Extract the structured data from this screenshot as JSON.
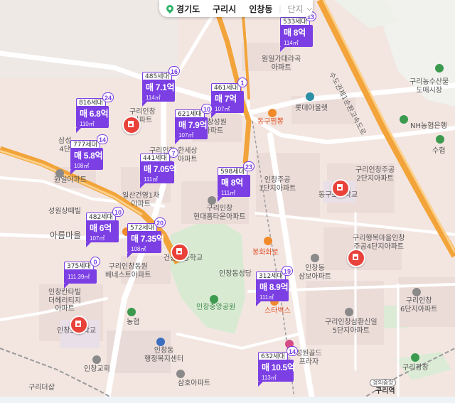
{
  "breadcrumb": {
    "province": "경기도",
    "city": "구리시",
    "district": "인창동",
    "filter": "단지"
  },
  "colors": {
    "marker": "#7b3fe4",
    "school": "#e8423a",
    "road": "#ffffff",
    "highway": "#f2a43a"
  },
  "markers": [
    {
      "households": "533세대",
      "price": "매 8억",
      "area": "114㎡",
      "count": "13"
    },
    {
      "households": "485세대",
      "price": "매 7.1억",
      "area": "114㎡",
      "count": "16"
    },
    {
      "households": "461세대",
      "price": "매 7억",
      "area": "107㎡",
      "count": "1"
    },
    {
      "households": "816세대",
      "price": "매 6.8억",
      "area": "110㎡",
      "count": "24"
    },
    {
      "households": "621세대",
      "price": "매 7.9억",
      "area": "107㎡",
      "count": "10"
    },
    {
      "households": "777세대",
      "price": "매 5.8억",
      "area": "108㎡",
      "count": "14"
    },
    {
      "households": "441세대",
      "price": "매 7.05억",
      "area": "111㎡",
      "count": "7"
    },
    {
      "households": "598세대",
      "price": "매 8억",
      "area": "111㎡",
      "count": "23"
    },
    {
      "households": "482세대",
      "price": "매 6억",
      "area": "107㎡",
      "count": "10"
    },
    {
      "households": "572세대",
      "price": "매 7.35억",
      "area": "108㎡",
      "count": "20"
    },
    {
      "households": "375세대",
      "price": "",
      "area": "111.39㎡",
      "count": "0"
    },
    {
      "households": "312세대",
      "price": "매 8.9억",
      "area": "111㎡",
      "count": "19"
    },
    {
      "households": "632세대",
      "price": "매 10.5억",
      "area": "113㎡",
      "count": "14"
    }
  ],
  "labels": {
    "wonil_garden": "원일가대라곡\n아파트",
    "lottedeli": "롯데아울렛",
    "dongguchan": "동구찜뽕",
    "guri_nongsusan": "구리농수산물\n도매시장",
    "nh": "NH농협은행",
    "sudo": "수협",
    "sudokwon_road": "수도권제1순환고속도로",
    "inchang_jugong1": "인창주공\n1단지아파트",
    "inchang_jugong2": "구리인창주공\n2단지아파트",
    "donggu_elem": "동구초등학교",
    "guri_haengbok": "구리행복마을인창\n주공4단지아파트",
    "guri_inchang_hyundai": "구리인창\n현대홈타운아파트",
    "sungwon_samae": "성원상떼빌",
    "areumaeul": "아름마을",
    "ilsan_hanyeong": "일산건영1차\n아파트",
    "wonil_apt": "원일아파트",
    "geonwon_elem": "건원초등학교",
    "inchang_sungdang": "인창동성당",
    "bonghwa": "봉화화로",
    "inchang_samboa": "인창동\n삼보아파트",
    "inchang_park": "인창중앙공원",
    "starbucks": "스타벅스",
    "inchang_6": "구리인창\n6단지아파트",
    "inchang_samhwan": "구리인창삼환신일\n5단지아파트",
    "inchang_elem": "인창초등학교",
    "nonghyup": "농협",
    "inchang_cantil": "인창칸타빌\n더헤리티지\n아파트",
    "inchang_haengjeong": "인창동\n행정복지센터",
    "inchang_church": "인창교회",
    "samho": "삼호아파트",
    "sungwon_park": "성원골드\n프라자",
    "guri_plaza": "구리광장",
    "gyeongui": "경의중앙",
    "guri_station": "구리역",
    "guri_dasan": "구리더샵",
    "beneste": "구리인창동원\n베네스트아파트",
    "guri_inchang_sungwon": "인창성원\n아파트",
    "hanse": "한세상\n아파트",
    "inchang_top": "구리인창\n아파트",
    "samsung4": "삼성\n4단",
    "guri_inchang_sung": "구리인창\n아파트"
  }
}
